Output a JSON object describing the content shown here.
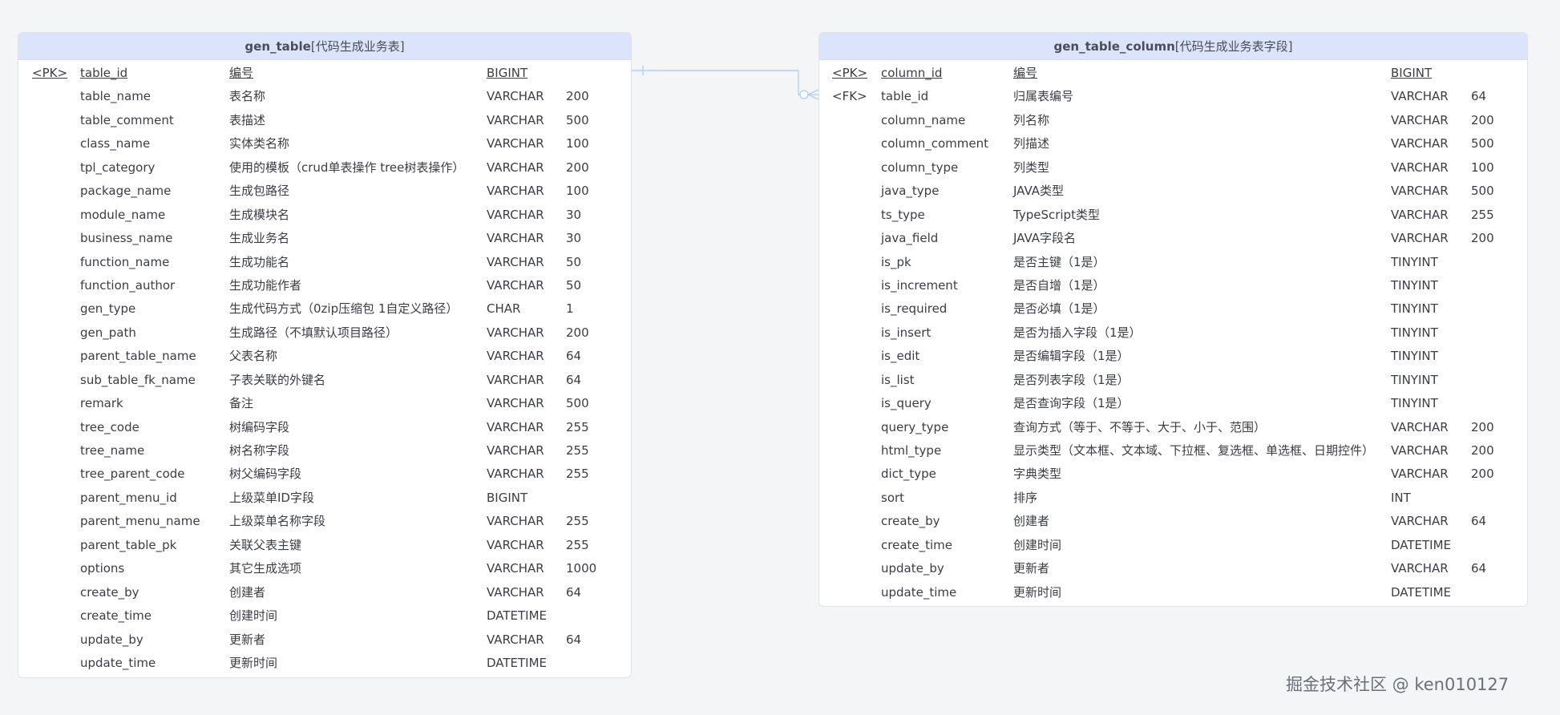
{
  "tables": [
    {
      "name": "gen_table",
      "comment": "[代码生成业务表]",
      "columns": [
        [
          "<PK>",
          "table_id",
          "编号",
          "BIGINT",
          ""
        ],
        [
          "",
          "table_name",
          "表名称",
          "VARCHAR",
          "200"
        ],
        [
          "",
          "table_comment",
          "表描述",
          "VARCHAR",
          "500"
        ],
        [
          "",
          "class_name",
          "实体类名称",
          "VARCHAR",
          "100"
        ],
        [
          "",
          "tpl_category",
          "使用的模板（crud单表操作 tree树表操作）",
          "VARCHAR",
          "200"
        ],
        [
          "",
          "package_name",
          "生成包路径",
          "VARCHAR",
          "100"
        ],
        [
          "",
          "module_name",
          "生成模块名",
          "VARCHAR",
          "30"
        ],
        [
          "",
          "business_name",
          "生成业务名",
          "VARCHAR",
          "30"
        ],
        [
          "",
          "function_name",
          "生成功能名",
          "VARCHAR",
          "50"
        ],
        [
          "",
          "function_author",
          "生成功能作者",
          "VARCHAR",
          "50"
        ],
        [
          "",
          "gen_type",
          "生成代码方式（0zip压缩包 1自定义路径）",
          "CHAR",
          "1"
        ],
        [
          "",
          "gen_path",
          "生成路径（不填默认项目路径）",
          "VARCHAR",
          "200"
        ],
        [
          "",
          "parent_table_name",
          "父表名称",
          "VARCHAR",
          "64"
        ],
        [
          "",
          "sub_table_fk_name",
          "子表关联的外键名",
          "VARCHAR",
          "64"
        ],
        [
          "",
          "remark",
          "备注",
          "VARCHAR",
          "500"
        ],
        [
          "",
          "tree_code",
          "树编码字段",
          "VARCHAR",
          "255"
        ],
        [
          "",
          "tree_name",
          "树名称字段",
          "VARCHAR",
          "255"
        ],
        [
          "",
          "tree_parent_code",
          "树父编码字段",
          "VARCHAR",
          "255"
        ],
        [
          "",
          "parent_menu_id",
          "上级菜单ID字段",
          "BIGINT",
          ""
        ],
        [
          "",
          "parent_menu_name",
          "上级菜单名称字段",
          "VARCHAR",
          "255"
        ],
        [
          "",
          "parent_table_pk",
          "关联父表主键",
          "VARCHAR",
          "255"
        ],
        [
          "",
          "options",
          "其它生成选项",
          "VARCHAR",
          "1000"
        ],
        [
          "",
          "create_by",
          "创建者",
          "VARCHAR",
          "64"
        ],
        [
          "",
          "create_time",
          "创建时间",
          "DATETIME",
          ""
        ],
        [
          "",
          "update_by",
          "更新者",
          "VARCHAR",
          "64"
        ],
        [
          "",
          "update_time",
          "更新时间",
          "DATETIME",
          ""
        ]
      ]
    },
    {
      "name": "gen_table_column",
      "comment": "[代码生成业务表字段]",
      "columns": [
        [
          "<PK>",
          "column_id",
          "编号",
          "BIGINT",
          ""
        ],
        [
          "<FK>",
          "table_id",
          "归属表编号",
          "VARCHAR",
          "64"
        ],
        [
          "",
          "column_name",
          "列名称",
          "VARCHAR",
          "200"
        ],
        [
          "",
          "column_comment",
          "列描述",
          "VARCHAR",
          "500"
        ],
        [
          "",
          "column_type",
          "列类型",
          "VARCHAR",
          "100"
        ],
        [
          "",
          "java_type",
          "JAVA类型",
          "VARCHAR",
          "500"
        ],
        [
          "",
          "ts_type",
          "TypeScript类型",
          "VARCHAR",
          "255"
        ],
        [
          "",
          "java_field",
          "JAVA字段名",
          "VARCHAR",
          "200"
        ],
        [
          "",
          "is_pk",
          "是否主键（1是）",
          "TINYINT",
          ""
        ],
        [
          "",
          "is_increment",
          "是否自增（1是）",
          "TINYINT",
          ""
        ],
        [
          "",
          "is_required",
          "是否必填（1是）",
          "TINYINT",
          ""
        ],
        [
          "",
          "is_insert",
          "是否为插入字段（1是）",
          "TINYINT",
          ""
        ],
        [
          "",
          "is_edit",
          "是否编辑字段（1是）",
          "TINYINT",
          ""
        ],
        [
          "",
          "is_list",
          "是否列表字段（1是）",
          "TINYINT",
          ""
        ],
        [
          "",
          "is_query",
          "是否查询字段（1是）",
          "TINYINT",
          ""
        ],
        [
          "",
          "query_type",
          "查询方式（等于、不等于、大于、小于、范围）",
          "VARCHAR",
          "200"
        ],
        [
          "",
          "html_type",
          "显示类型（文本框、文本域、下拉框、复选框、单选框、日期控件）",
          "VARCHAR",
          "200"
        ],
        [
          "",
          "dict_type",
          "字典类型",
          "VARCHAR",
          "200"
        ],
        [
          "",
          "sort",
          "排序",
          "INT",
          ""
        ],
        [
          "",
          "create_by",
          "创建者",
          "VARCHAR",
          "64"
        ],
        [
          "",
          "create_time",
          "创建时间",
          "DATETIME",
          ""
        ],
        [
          "",
          "update_by",
          "更新者",
          "VARCHAR",
          "64"
        ],
        [
          "",
          "update_time",
          "更新时间",
          "DATETIME",
          ""
        ]
      ]
    }
  ],
  "watermark": "掘金技术社区 @ ken010127",
  "colors": {
    "header_bg": "#dce4fb",
    "relation_line": "#a9cbef"
  }
}
